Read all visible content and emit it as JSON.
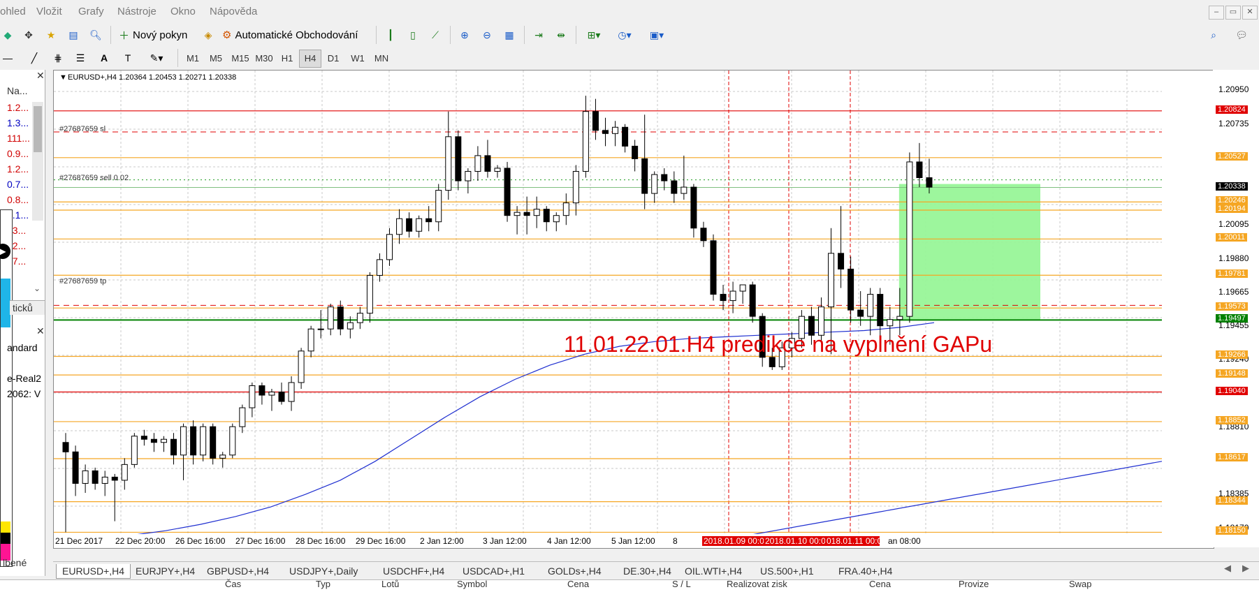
{
  "menu": [
    "ohled",
    "Vložit",
    "Grafy",
    "Nástroje",
    "Okno",
    "Nápověda"
  ],
  "window_controls": [
    "–",
    "▭",
    "✕"
  ],
  "toolbar": {
    "new_order_label": "Nový pokyn",
    "auto_trading_label": "Automatické Obchodování"
  },
  "timeframes": [
    "M1",
    "M5",
    "M15",
    "M30",
    "H1",
    "H4",
    "D1",
    "W1",
    "MN"
  ],
  "active_timeframe": "H4",
  "left_panel": {
    "header": "Na...",
    "values": [
      {
        "text": "1.2...",
        "color": "#d00000"
      },
      {
        "text": "1.3...",
        "color": "#0000c0"
      },
      {
        "text": "111...",
        "color": "#d00000"
      },
      {
        "text": "0.9...",
        "color": "#d00000"
      },
      {
        "text": "1.2...",
        "color": "#d00000"
      },
      {
        "text": "0.7...",
        "color": "#0000c0"
      },
      {
        "text": "0.8...",
        "color": "#d00000"
      },
      {
        "text": "1.1...",
        "color": "#0000c0"
      },
      {
        "text": "33...",
        "color": "#d00000"
      },
      {
        "text": "32...",
        "color": "#d00000"
      },
      {
        "text": "17...",
        "color": "#d00000"
      }
    ],
    "ticks_tab": "ticků",
    "account_type": "andard",
    "server": "e-Real2",
    "account": "2062: V",
    "favorites_tab": "lbené"
  },
  "chart_header": "EURUSD+,H4  1.20364 1.20453 1.20271 1.20338",
  "order_labels": {
    "sl": "#27687659 sl",
    "sell": "#27687659 sell 0.02",
    "tp": "#27687659 tp"
  },
  "annotation": "11.01.22.01.H4 predikce na vyplnění GAPu",
  "colors": {
    "annotation": "#e00000",
    "ma_line": "#1f2fd0",
    "rect": "#98f598",
    "level": "#f5a623"
  },
  "price_scale": {
    "min": 1.1805,
    "max": 1.2108,
    "ticks": [
      "1.20950",
      "1.20735",
      "1.20095",
      "1.19880",
      "1.19665",
      "1.19455",
      "1.19240",
      "1.18810",
      "1.18385",
      "1.18170"
    ],
    "tags": [
      {
        "label": "1.20824",
        "price": 1.20824,
        "bg": "#e00000"
      },
      {
        "label": "1.20527",
        "price": 1.20527,
        "bg": "#f5a623"
      },
      {
        "label": "1.20338",
        "price": 1.20338,
        "bg": "#000000"
      },
      {
        "label": "1.20246",
        "price": 1.20246,
        "bg": "#f5a623"
      },
      {
        "label": "1.20194",
        "price": 1.20194,
        "bg": "#f5a623"
      },
      {
        "label": "1.20011",
        "price": 1.20011,
        "bg": "#f5a623"
      },
      {
        "label": "1.19781",
        "price": 1.19781,
        "bg": "#f5a623"
      },
      {
        "label": "1.19573",
        "price": 1.19573,
        "bg": "#f5a623"
      },
      {
        "label": "1.19497",
        "price": 1.19497,
        "bg": "#008000"
      },
      {
        "label": "1.19266",
        "price": 1.19266,
        "bg": "#f5a623"
      },
      {
        "label": "1.19148",
        "price": 1.19148,
        "bg": "#f5a623"
      },
      {
        "label": "1.19040",
        "price": 1.1904,
        "bg": "#e00000"
      },
      {
        "label": "1.18852",
        "price": 1.18852,
        "bg": "#f5a623"
      },
      {
        "label": "1.18617",
        "price": 1.18617,
        "bg": "#f5a623"
      },
      {
        "label": "1.18344",
        "price": 1.18344,
        "bg": "#f5a623"
      },
      {
        "label": "1.18150",
        "price": 1.1815,
        "bg": "#f5a623"
      }
    ]
  },
  "time_axis": [
    "21 Dec 2017",
    "22 Dec 20:00",
    "26 Dec 16:00",
    "27 Dec 16:00",
    "28 Dec 16:00",
    "29 Dec 16:00",
    "2 Jan 12:00",
    "3 Jan 12:00",
    "4 Jan 12:00",
    "5 Jan 12:00",
    "8",
    "2018.01.09 00:0",
    "2018.01.10 00:00",
    "018.01.11 00:00",
    "an 08:00"
  ],
  "tabs": [
    "EURUSD+,H4",
    "EURJPY+,H4",
    "GBPUSD+,H4",
    "USDJPY+,Daily",
    "USDCHF+,H4",
    "USDCAD+,H1",
    "GOLDs+,H4",
    "DE.30+,H4",
    "OIL.WTI+,H4",
    "US.500+,H1",
    "FRA.40+,H4"
  ],
  "bottom_headers": [
    "Čas",
    "Typ",
    "Lotů",
    "Symbol",
    "Cena",
    "S / L",
    "Realizovat zisk",
    "Cena",
    "Provize",
    "Swap"
  ],
  "chart_data": {
    "type": "candlestick",
    "symbol": "EURUSD+",
    "timeframe": "H4",
    "ohlc": [
      [
        1.1872,
        1.1878,
        1.1815,
        1.1866
      ],
      [
        1.1866,
        1.187,
        1.1838,
        1.1846
      ],
      [
        1.1846,
        1.1858,
        1.184,
        1.1854
      ],
      [
        1.1854,
        1.1856,
        1.1842,
        1.1846
      ],
      [
        1.1846,
        1.1854,
        1.1838,
        1.185
      ],
      [
        1.185,
        1.1852,
        1.1822,
        1.1848
      ],
      [
        1.1848,
        1.1862,
        1.1842,
        1.1858
      ],
      [
        1.1858,
        1.1878,
        1.1856,
        1.1876
      ],
      [
        1.1876,
        1.188,
        1.187,
        1.1874
      ],
      [
        1.1874,
        1.1878,
        1.1866,
        1.1872
      ],
      [
        1.1872,
        1.1876,
        1.1866,
        1.1874
      ],
      [
        1.1874,
        1.1878,
        1.1858,
        1.1864
      ],
      [
        1.1864,
        1.1884,
        1.1848,
        1.1882
      ],
      [
        1.1882,
        1.1886,
        1.1858,
        1.1864
      ],
      [
        1.1864,
        1.1884,
        1.186,
        1.1882
      ],
      [
        1.1882,
        1.1884,
        1.1858,
        1.1862
      ],
      [
        1.1862,
        1.1866,
        1.1856,
        1.1864
      ],
      [
        1.1864,
        1.1884,
        1.1862,
        1.1882
      ],
      [
        1.1882,
        1.1896,
        1.1878,
        1.1894
      ],
      [
        1.1894,
        1.191,
        1.1888,
        1.1908
      ],
      [
        1.1908,
        1.191,
        1.1896,
        1.1902
      ],
      [
        1.1902,
        1.1906,
        1.1892,
        1.1904
      ],
      [
        1.1904,
        1.191,
        1.1896,
        1.1898
      ],
      [
        1.1898,
        1.1914,
        1.1892,
        1.191
      ],
      [
        1.191,
        1.1932,
        1.1906,
        1.193
      ],
      [
        1.193,
        1.1946,
        1.1926,
        1.1944
      ],
      [
        1.1944,
        1.1956,
        1.1938,
        1.1944
      ],
      [
        1.1944,
        1.196,
        1.194,
        1.1958
      ],
      [
        1.1958,
        1.1962,
        1.194,
        1.1944
      ],
      [
        1.1944,
        1.1952,
        1.1938,
        1.1948
      ],
      [
        1.1948,
        1.1958,
        1.1944,
        1.1954
      ],
      [
        1.1954,
        1.198,
        1.1948,
        1.1978
      ],
      [
        1.1978,
        1.1992,
        1.1974,
        1.1988
      ],
      [
        1.1988,
        1.2008,
        1.1984,
        1.2004
      ],
      [
        1.2004,
        1.202,
        1.1998,
        1.2014
      ],
      [
        1.2014,
        1.2018,
        1.2002,
        1.2006
      ],
      [
        1.2006,
        1.2016,
        1.2002,
        1.2014
      ],
      [
        1.2014,
        1.2022,
        1.2006,
        1.2012
      ],
      [
        1.2012,
        1.2036,
        1.2006,
        1.2032
      ],
      [
        1.2032,
        1.2082,
        1.2026,
        1.2066
      ],
      [
        1.2066,
        1.207,
        1.2032,
        1.2038
      ],
      [
        1.2038,
        1.2046,
        1.203,
        1.2044
      ],
      [
        1.2044,
        1.206,
        1.2038,
        1.2054
      ],
      [
        1.2054,
        1.2064,
        1.204,
        1.2044
      ],
      [
        1.2044,
        1.2048,
        1.204,
        1.2046
      ],
      [
        1.2046,
        1.205,
        1.2012,
        1.2016
      ],
      [
        1.2016,
        1.2022,
        1.2004,
        1.2018
      ],
      [
        1.2018,
        1.2028,
        1.2004,
        1.2016
      ],
      [
        1.2016,
        1.2028,
        1.2008,
        1.202
      ],
      [
        1.202,
        1.2022,
        1.2006,
        1.2012
      ],
      [
        1.2012,
        1.2018,
        1.2006,
        1.2016
      ],
      [
        1.2016,
        1.203,
        1.201,
        1.2024
      ],
      [
        1.2024,
        1.2048,
        1.2016,
        1.2044
      ],
      [
        1.2044,
        1.2092,
        1.204,
        1.2082
      ],
      [
        1.2082,
        1.209,
        1.2064,
        1.207
      ],
      [
        1.207,
        1.2078,
        1.206,
        1.2068
      ],
      [
        1.2068,
        1.2076,
        1.206,
        1.2072
      ],
      [
        1.2072,
        1.2074,
        1.2056,
        1.206
      ],
      [
        1.206,
        1.2064,
        1.2044,
        1.2052
      ],
      [
        1.2052,
        1.208,
        1.202,
        1.203
      ],
      [
        1.203,
        1.2044,
        1.2024,
        1.2042
      ],
      [
        1.2042,
        1.2046,
        1.2032,
        1.2038
      ],
      [
        1.2038,
        1.2044,
        1.2024,
        1.203
      ],
      [
        1.203,
        1.2054,
        1.2026,
        1.2034
      ],
      [
        1.2034,
        1.2036,
        1.2002,
        1.2008
      ],
      [
        1.2008,
        1.2012,
        1.1996,
        1.2
      ],
      [
        1.2,
        1.2004,
        1.1962,
        1.1966
      ],
      [
        1.1966,
        1.1972,
        1.1956,
        1.1962
      ],
      [
        1.1962,
        1.1974,
        1.1954,
        1.1968
      ],
      [
        1.1968,
        1.1972,
        1.196,
        1.1972
      ],
      [
        1.1972,
        1.1974,
        1.1948,
        1.1952
      ],
      [
        1.1952,
        1.1954,
        1.192,
        1.1926
      ],
      [
        1.1926,
        1.1932,
        1.1918,
        1.192
      ],
      [
        1.192,
        1.1936,
        1.1918,
        1.1932
      ],
      [
        1.1932,
        1.1942,
        1.1926,
        1.1938
      ],
      [
        1.1938,
        1.1956,
        1.1932,
        1.1952
      ],
      [
        1.1952,
        1.1958,
        1.1934,
        1.194
      ],
      [
        1.194,
        1.1964,
        1.1936,
        1.1958
      ],
      [
        1.1958,
        1.2008,
        1.1928,
        1.1992
      ],
      [
        1.1992,
        1.2022,
        1.197,
        1.1982
      ],
      [
        1.1982,
        1.199,
        1.1948,
        1.1956
      ],
      [
        1.1956,
        1.1968,
        1.1946,
        1.1952
      ],
      [
        1.1952,
        1.197,
        1.194,
        1.1966
      ],
      [
        1.1966,
        1.197,
        1.1938,
        1.1946
      ],
      [
        1.1946,
        1.1958,
        1.1934,
        1.195
      ],
      [
        1.195,
        1.197,
        1.194,
        1.1952
      ],
      [
        1.1952,
        1.2056,
        1.1948,
        1.205
      ],
      [
        1.205,
        1.2062,
        1.2034,
        1.204
      ],
      [
        1.204,
        1.2052,
        1.203,
        1.2034
      ]
    ],
    "ma": [
      1.1808,
      1.181,
      1.1813,
      1.1816,
      1.182,
      1.1825,
      1.1831,
      1.1839,
      1.1848,
      1.186,
      1.1874,
      1.1888,
      1.1901,
      1.1912,
      1.1921,
      1.1928,
      1.1933,
      1.1936,
      1.1938,
      1.1939,
      1.194,
      1.1941,
      1.1942,
      1.1943,
      1.1945,
      1.1948
    ],
    "ma2": [
      1.1805,
      1.1812,
      1.182,
      1.1828,
      1.1836,
      1.1844,
      1.1852,
      1.186
    ]
  }
}
